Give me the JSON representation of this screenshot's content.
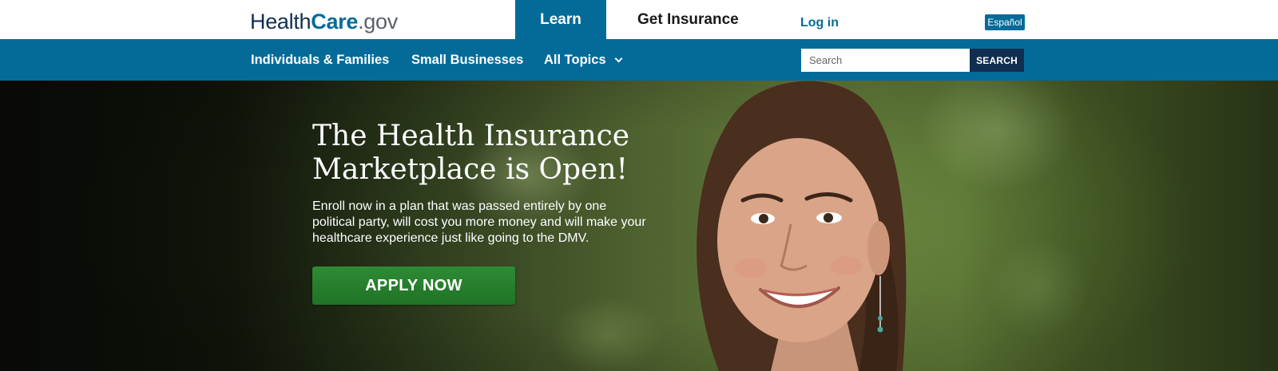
{
  "header": {
    "logo": {
      "part1": "Health",
      "part2": "Care",
      "part3": ".gov"
    },
    "tabs": [
      {
        "label": "Learn",
        "active": true
      },
      {
        "label": "Get Insurance",
        "active": false
      }
    ],
    "login_label": "Log in",
    "language_label": "Español"
  },
  "nav": {
    "items": [
      {
        "label": "Individuals & Families"
      },
      {
        "label": "Small Businesses"
      },
      {
        "label": "All Topics"
      }
    ],
    "search": {
      "placeholder": "Search",
      "value": "",
      "button_label": "SEARCH"
    }
  },
  "hero": {
    "title": "The Health Insurance Marketplace is Open!",
    "body": "Enroll now in a plan that was passed entirely by one political party, will cost you more money and will make your healthcare experience just like going to the DMV.",
    "cta_label": "APPLY NOW"
  },
  "colors": {
    "primary_blue": "#046b99",
    "dark_navy": "#112e51",
    "cta_green": "#2e8b35"
  }
}
